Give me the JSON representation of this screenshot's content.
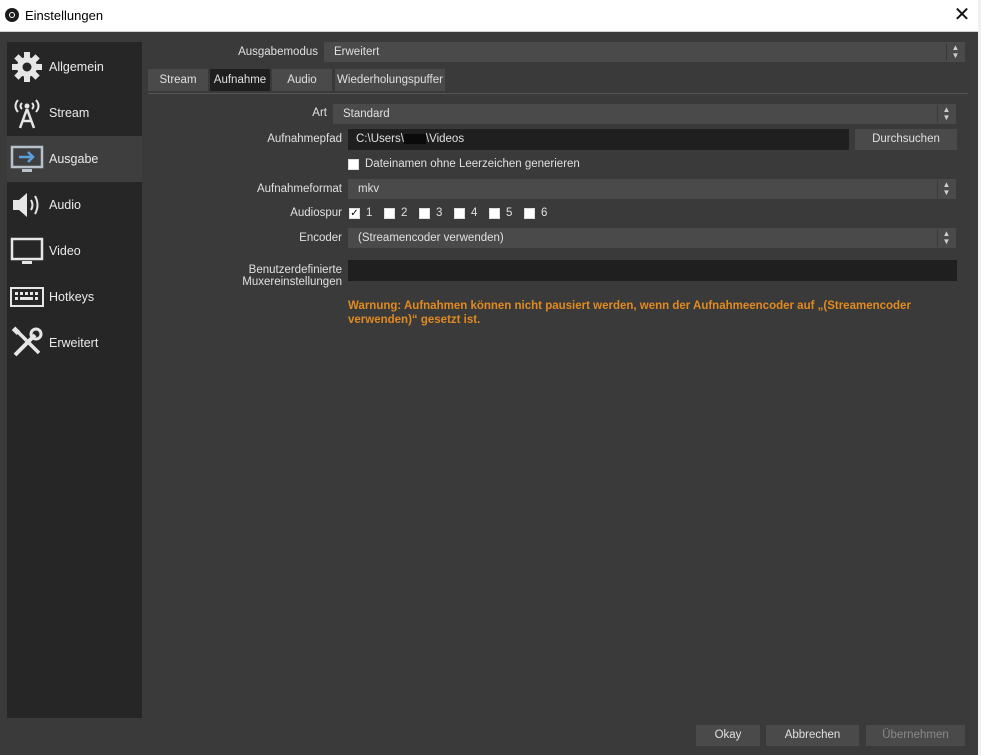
{
  "window": {
    "title": "Einstellungen"
  },
  "sidebar": {
    "items": [
      {
        "label": "Allgemein",
        "icon": "gear-icon"
      },
      {
        "label": "Stream",
        "icon": "broadcast-tower-icon"
      },
      {
        "label": "Ausgabe",
        "icon": "output-monitor-icon",
        "active": true
      },
      {
        "label": "Audio",
        "icon": "speaker-icon"
      },
      {
        "label": "Video",
        "icon": "monitor-icon"
      },
      {
        "label": "Hotkeys",
        "icon": "keyboard-icon"
      },
      {
        "label": "Erweitert",
        "icon": "tools-icon"
      }
    ]
  },
  "output": {
    "mode_label": "Ausgabemodus",
    "mode_value": "Erweitert",
    "tabs": [
      {
        "label": "Stream"
      },
      {
        "label": "Aufnahme",
        "active": true
      },
      {
        "label": "Audio"
      },
      {
        "label": "Wiederholungspuffer"
      }
    ]
  },
  "recording": {
    "type_label": "Art",
    "type_value": "Standard",
    "path_label": "Aufnahmepfad",
    "path_value": "C:\\Users\\",
    "path_value_end": "\\Videos",
    "browse_label": "Durchsuchen",
    "no_spaces_label": "Dateinamen ohne Leerzeichen generieren",
    "no_spaces_checked": false,
    "format_label": "Aufnahmeformat",
    "format_value": "mkv",
    "audio_track_label": "Audiospur",
    "audio_tracks": [
      {
        "label": "1",
        "checked": true
      },
      {
        "label": "2",
        "checked": false
      },
      {
        "label": "3",
        "checked": false
      },
      {
        "label": "4",
        "checked": false
      },
      {
        "label": "5",
        "checked": false
      },
      {
        "label": "6",
        "checked": false
      }
    ],
    "encoder_label": "Encoder",
    "encoder_value": "(Streamencoder verwenden)",
    "muxer_label": "Benutzerdefinierte Muxereinstellungen",
    "muxer_value": "",
    "warning": "Warnung: Aufnahmen können nicht pausiert werden, wenn der Aufnahmeencoder auf „(Streamencoder verwenden)“ gesetzt ist."
  },
  "footer": {
    "ok_label": "Okay",
    "cancel_label": "Abbrechen",
    "apply_label": "Übernehmen"
  },
  "colors": {
    "background": "#3a3a3a",
    "sidebar": "#262626",
    "warning": "#e08a20"
  }
}
